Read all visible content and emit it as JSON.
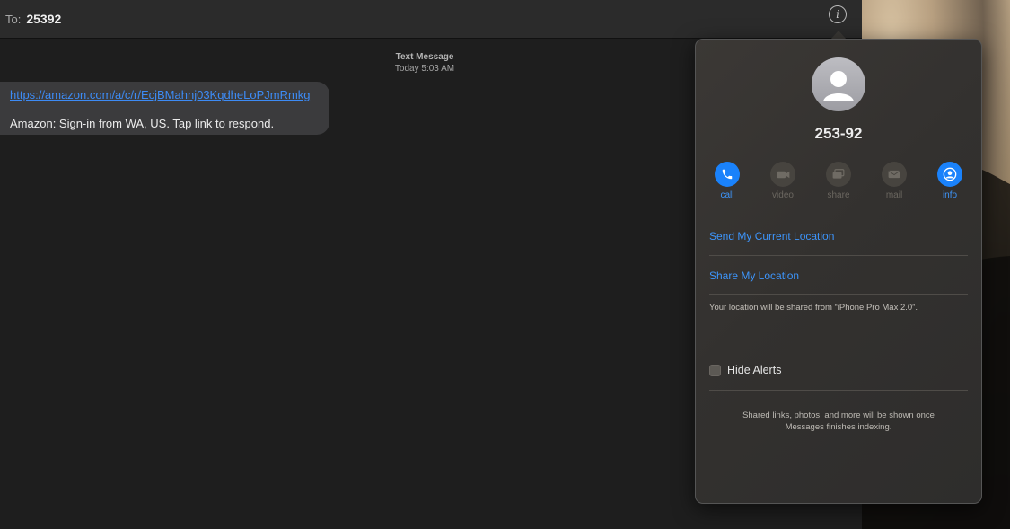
{
  "header": {
    "to_label": "To:",
    "recipient": "25392"
  },
  "conversation": {
    "message_kind": "Text Message",
    "timestamp": "Today 5:03 AM",
    "messages": [
      {
        "link": "https://amazon.com/a/c/r/EcjBMahnj03KqdheLoPJmRmkg",
        "text": "Amazon: Sign-in from WA, US. Tap link to respond."
      }
    ]
  },
  "details": {
    "contact_name": "253-92",
    "actions": [
      {
        "label": "call",
        "icon": "phone-icon",
        "enabled": true
      },
      {
        "label": "video",
        "icon": "video-camera-icon",
        "enabled": false
      },
      {
        "label": "share",
        "icon": "screen-share-icon",
        "enabled": false
      },
      {
        "label": "mail",
        "icon": "envelope-icon",
        "enabled": false
      },
      {
        "label": "info",
        "icon": "person-circle-icon",
        "enabled": true
      }
    ],
    "send_location": "Send My Current Location",
    "share_location": "Share My Location",
    "location_note": "Your location will be shared from “iPhone Pro Max 2.0”.",
    "hide_alerts": {
      "label": "Hide Alerts",
      "checked": false
    },
    "indexing_note_line1": "Shared links, photos, and more will be shown once",
    "indexing_note_line2": "Messages finishes indexing."
  },
  "colors": {
    "accent": "#1a82fb",
    "link": "#3d8bf5",
    "bubble": "#3b3b3d",
    "window_bg": "#1e1e1e"
  }
}
